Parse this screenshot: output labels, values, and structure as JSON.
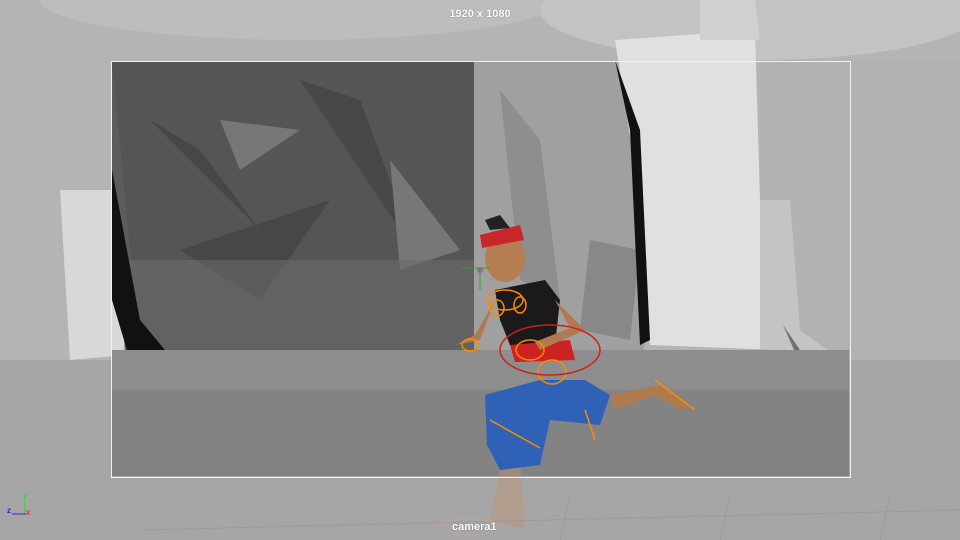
{
  "viewport": {
    "resolution_label": "1920 x 1080",
    "camera_label": "camera1",
    "axes": {
      "x": "x",
      "y": "y",
      "z": "z"
    },
    "colors": {
      "x_axis": "#ff2a2a",
      "y_axis": "#22dd22",
      "z_axis": "#2020ff",
      "resolution_gate": "#f2f2f2",
      "controls": "#ff8a00"
    }
  }
}
